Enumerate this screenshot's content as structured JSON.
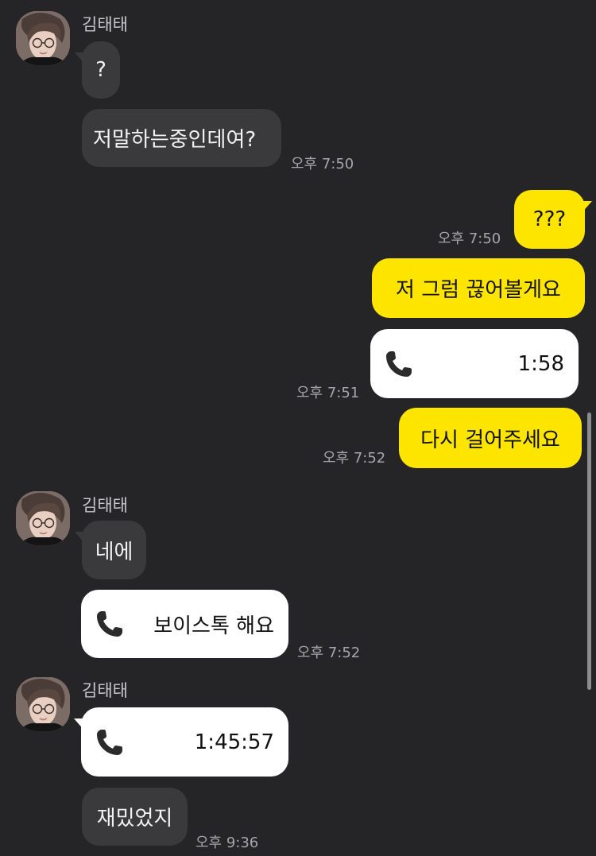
{
  "messages": {
    "sender_name": "김태태",
    "m1": "?",
    "m2": "저말하는중인데여?",
    "t1": "오후 7:50",
    "m3": "???",
    "t2": "오후 7:50",
    "m4": "저 그럼 끊어볼게요",
    "call1_duration": "1:58",
    "t3": "오후 7:51",
    "m5": "다시 걸어주세요",
    "t4": "오후 7:52",
    "m6": "네에",
    "call2_label": "보이스톡 해요",
    "t5": "오후 7:52",
    "call3_duration": "1:45:57",
    "m7": "재밌었지",
    "t6": "오후 9:36"
  },
  "colors": {
    "background": "#252527",
    "incoming_bubble": "#3a3a3c",
    "outgoing_bubble": "#fee500",
    "call_bubble": "#ffffff"
  },
  "icons": [
    "avatar",
    "phone-icon"
  ]
}
